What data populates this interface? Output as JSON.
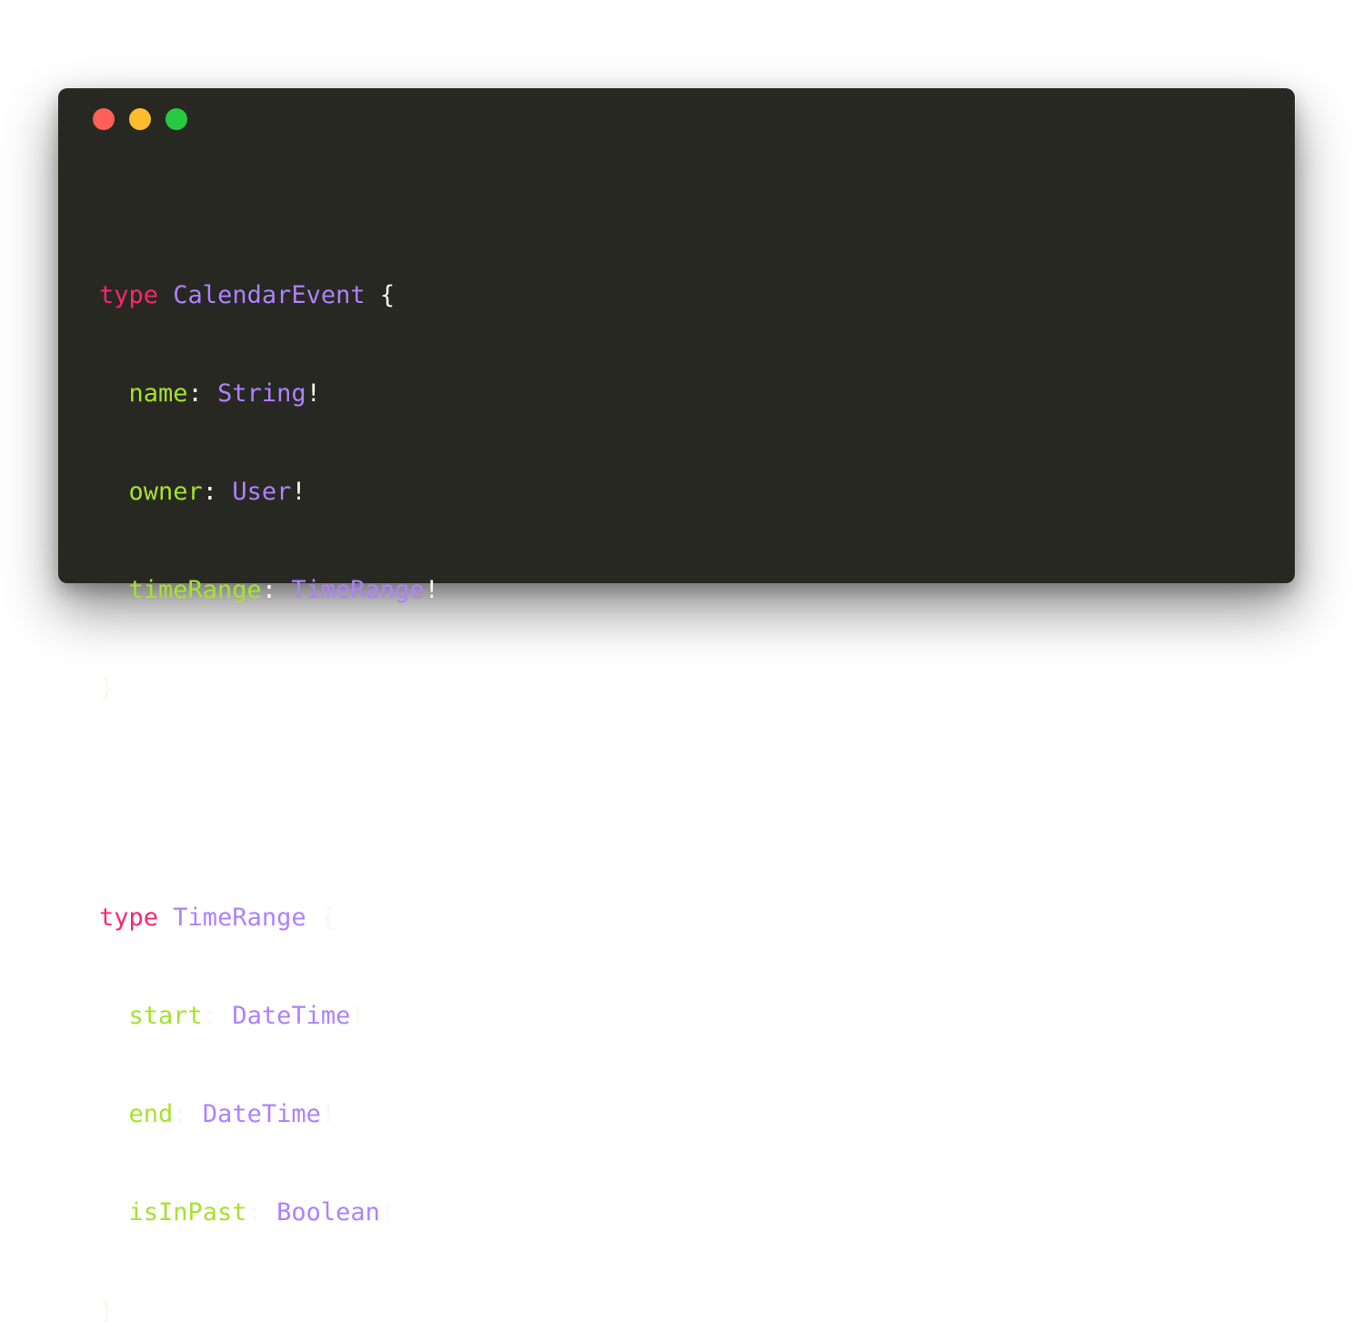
{
  "colors": {
    "background": "#ffffff",
    "window": "#282823",
    "close": "#ff5f56",
    "minimize": "#ffbd2e",
    "maximize": "#27c93f",
    "keyword": "#f92672",
    "type_name": "#ae81ff",
    "field": "#a6e22e",
    "punctuation": "#f8f8f2"
  },
  "window_controls": [
    "close",
    "minimize",
    "maximize"
  ],
  "code": {
    "blocks": [
      {
        "keyword": "type",
        "name": "CalendarEvent",
        "open": "{",
        "close": "}",
        "fields": [
          {
            "name": "name",
            "type": "String"
          },
          {
            "name": "owner",
            "type": "User"
          },
          {
            "name": "timeRange",
            "type": "TimeRange"
          }
        ]
      },
      {
        "keyword": "type",
        "name": "TimeRange",
        "open": "{",
        "close": "}",
        "fields": [
          {
            "name": "start",
            "type": "DateTime"
          },
          {
            "name": "end",
            "type": "DateTime"
          },
          {
            "name": "isInPast",
            "type": "Boolean"
          }
        ]
      }
    ],
    "colon": ":",
    "bang": "!"
  }
}
